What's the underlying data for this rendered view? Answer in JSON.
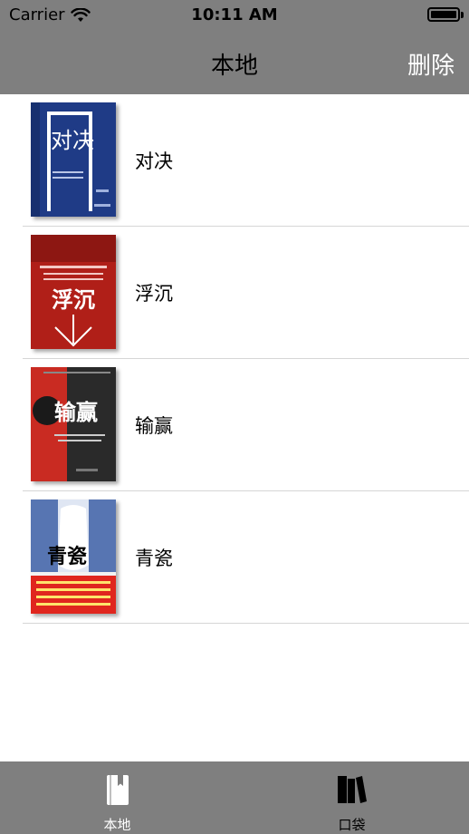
{
  "status_bar": {
    "carrier": "Carrier",
    "time": "10:11 AM",
    "battery_level": 1.0
  },
  "nav": {
    "title": "本地",
    "action_label": "删除"
  },
  "books": [
    {
      "title": "对决",
      "cover_text": "对决",
      "cover_colors": [
        "#1e3c8c",
        "#ffffff"
      ]
    },
    {
      "title": "浮沉",
      "cover_text": "浮沉",
      "cover_colors": [
        "#b3201a",
        "#ffffff"
      ]
    },
    {
      "title": "输赢",
      "cover_text": "输赢",
      "cover_colors": [
        "#2a2a2a",
        "#d4281d"
      ]
    },
    {
      "title": "青瓷",
      "cover_text": "青瓷",
      "cover_colors": [
        "#1d3f8a",
        "#e0261e"
      ]
    }
  ],
  "tabs": [
    {
      "label": "本地",
      "icon": "book-icon",
      "selected": true
    },
    {
      "label": "口袋",
      "icon": "books-shelf-icon",
      "selected": false
    }
  ],
  "colors": {
    "bar_background": "#7f7f7f",
    "separator": "#d6d6d6",
    "tab_selected": "#ffffff",
    "tab_unselected": "#000000"
  }
}
